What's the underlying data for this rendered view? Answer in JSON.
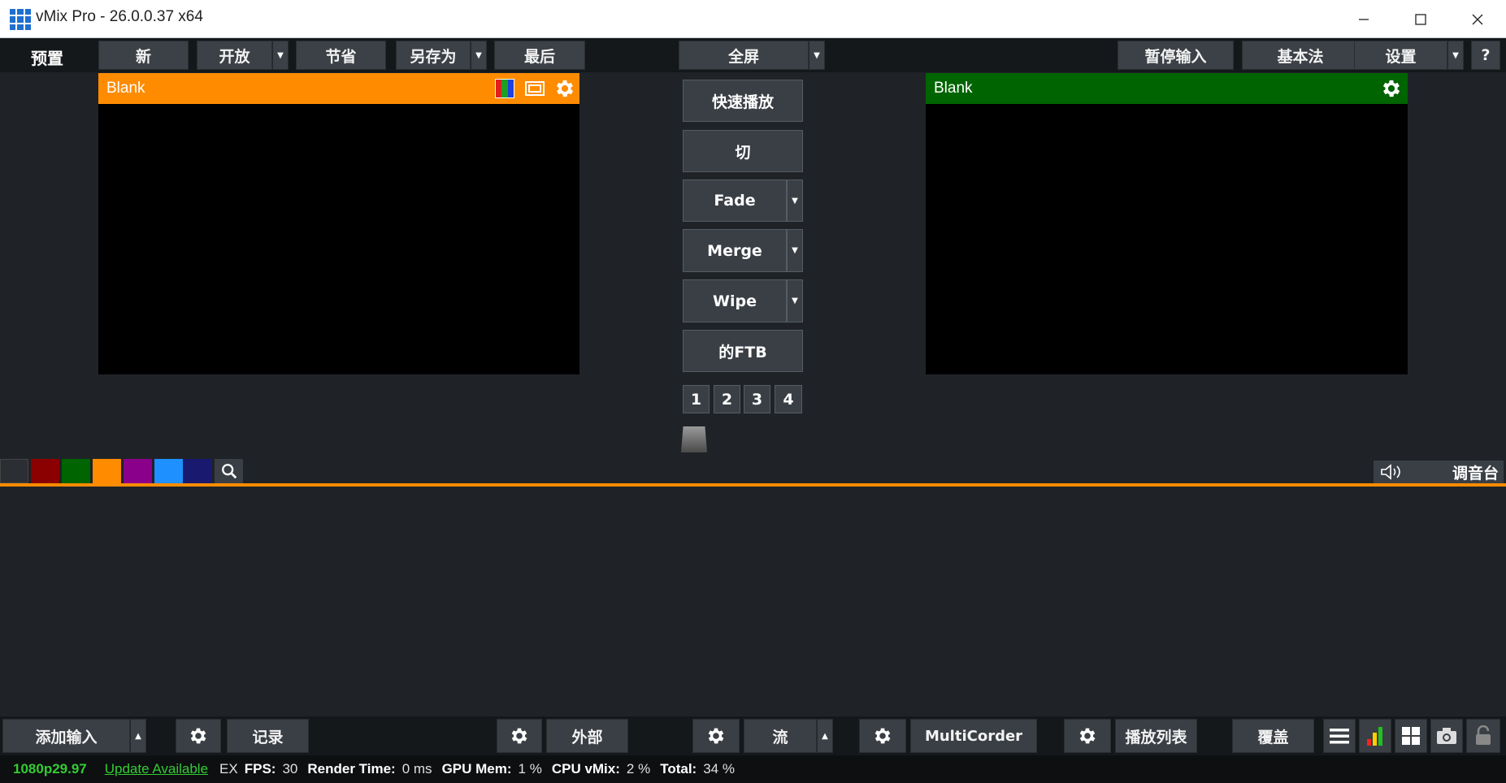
{
  "window": {
    "title": "vMix Pro - 26.0.0.37 x64"
  },
  "toolbar": {
    "preview_label": "预置",
    "new_label": "新",
    "open_label": "开放",
    "save_label": "节省",
    "save_as_label": "另存为",
    "last_label": "最后",
    "fullscreen_label": "全屏",
    "pause_inputs_label": "暂停输入",
    "basic_label": "基本法",
    "settings_label": "设置",
    "help_label": "?"
  },
  "preview_pane": {
    "title": "Blank",
    "header_color": "#ff8c00"
  },
  "output_pane": {
    "title": "Blank",
    "header_color": "#006400"
  },
  "transitions": {
    "quick_play": "快速播放",
    "cut": "切",
    "fade": "Fade",
    "merge": "Merge",
    "wipe": "Wipe",
    "ftb": "的FTB",
    "numbers": [
      "1",
      "2",
      "3",
      "4"
    ]
  },
  "color_filters": [
    "#2b2f34",
    "#8b0000",
    "#006400",
    "#ff8c00",
    "#8b008b",
    "#1e90ff",
    "#191970"
  ],
  "audio": {
    "mixer_label": "调音台"
  },
  "bottom_toolbar": {
    "add_input": "添加输入",
    "record": "记录",
    "external": "外部",
    "stream": "流",
    "multicorder": "MultiCorder",
    "playlist": "播放列表",
    "overlay": "覆盖"
  },
  "status": {
    "format": "1080p29.97",
    "update": "Update Available",
    "ex": "EX",
    "fps_label": "FPS:",
    "fps_value": "30",
    "render_label": "Render Time:",
    "render_value": "0 ms",
    "gpu_label": "GPU Mem:",
    "gpu_value": "1 %",
    "cpu_label": "CPU vMix:",
    "cpu_value": "2 %",
    "total_label": "Total:",
    "total_value": "34 %"
  }
}
